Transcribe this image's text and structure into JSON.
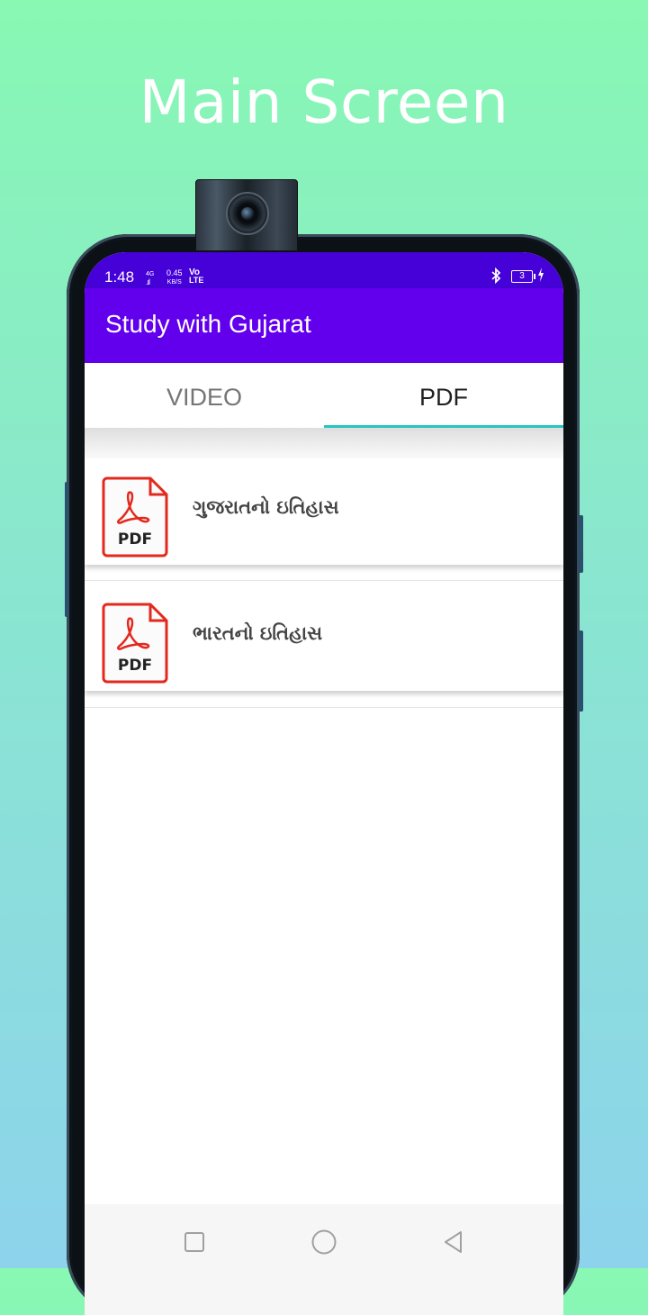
{
  "promo": {
    "title": "Main Screen"
  },
  "status_bar": {
    "time": "1:48",
    "signal": "4G",
    "speed_value": "0.45",
    "speed_unit": "KB/S",
    "volte_top": "Vo",
    "volte_bottom": "LTE",
    "battery": "3"
  },
  "app_bar": {
    "title": "Study with Gujarat"
  },
  "tabs": [
    {
      "label": "VIDEO",
      "selected": false
    },
    {
      "label": "PDF",
      "selected": true
    }
  ],
  "pdf_list": [
    {
      "icon_label": "PDF",
      "title": "ગુજરાતનો ઇતિહાસ"
    },
    {
      "icon_label": "PDF",
      "title": "ભારતનો ઇતિહાસ"
    }
  ],
  "colors": {
    "status_bar": "#4600d8",
    "app_bar": "#6200ee",
    "tab_indicator": "#26c6c0",
    "pdf_icon_red": "#e3291e"
  },
  "icons": {
    "pdf": "pdf-file-icon",
    "nav_recents": "square-icon",
    "nav_home": "circle-icon",
    "nav_back": "triangle-back-icon"
  }
}
